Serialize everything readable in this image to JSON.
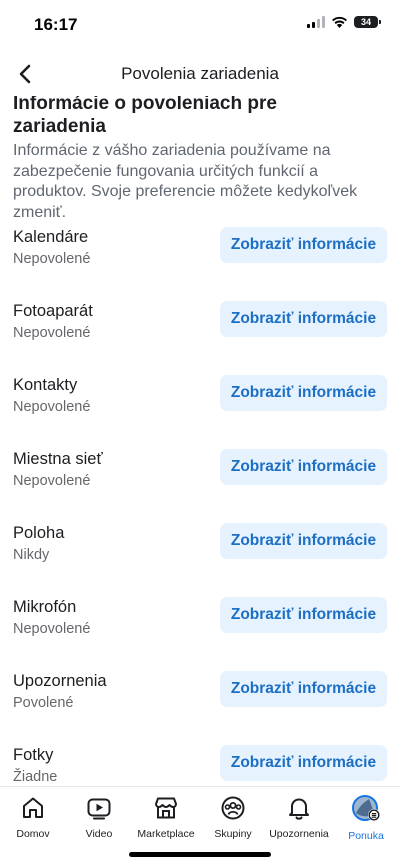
{
  "status_bar": {
    "time": "16:17",
    "battery": "34"
  },
  "header": {
    "title": "Povolenia zariadenia"
  },
  "section": {
    "heading_line1": "Informácie o povoleniach pre",
    "heading_line2": "zariadenia",
    "description": "Informácie z vášho zariadenia používame na zabezpečenie fungovania určitých funkcií a produktov. Svoje preferencie môžete kedykoľvek zmeniť."
  },
  "permissions": [
    {
      "name": "Kalendáre",
      "status": "Nepovolené",
      "button": "Zobraziť informácie"
    },
    {
      "name": "Fotoaparát",
      "status": "Nepovolené",
      "button": "Zobraziť informácie"
    },
    {
      "name": "Kontakty",
      "status": "Nepovolené",
      "button": "Zobraziť informácie"
    },
    {
      "name": "Miestna sieť",
      "status": "Nepovolené",
      "button": "Zobraziť informácie"
    },
    {
      "name": "Poloha",
      "status": "Nikdy",
      "button": "Zobraziť informácie"
    },
    {
      "name": "Mikrofón",
      "status": "Nepovolené",
      "button": "Zobraziť informácie"
    },
    {
      "name": "Upozornenia",
      "status": "Povolené",
      "button": "Zobraziť informácie"
    },
    {
      "name": "Fotky",
      "status": "Žiadne",
      "button": "Zobraziť informácie"
    }
  ],
  "tabbar": [
    {
      "label": "Domov",
      "icon": "home-icon"
    },
    {
      "label": "Video",
      "icon": "video-icon"
    },
    {
      "label": "Marketplace",
      "icon": "marketplace-icon"
    },
    {
      "label": "Skupiny",
      "icon": "groups-icon"
    },
    {
      "label": "Upozornenia",
      "icon": "bell-icon"
    },
    {
      "label": "Ponuka",
      "icon": "avatar-menu-icon",
      "active": true
    }
  ],
  "colors": {
    "accent": "#1b74e4",
    "button_bg": "#e6f2fd",
    "button_text": "#1d6fc4",
    "secondary_text": "#65676b"
  }
}
